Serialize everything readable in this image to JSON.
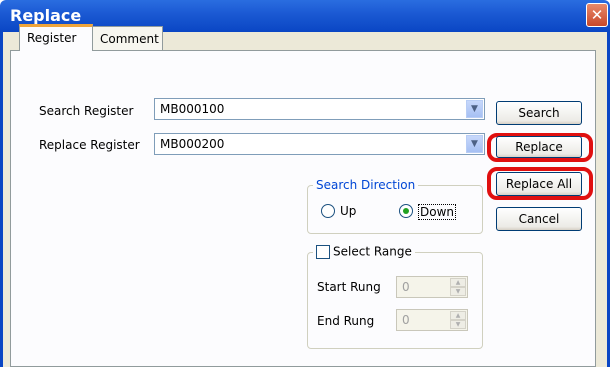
{
  "window": {
    "title": "Replace",
    "close_glyph": "✕"
  },
  "tabs": [
    {
      "label": "Register",
      "active": true
    },
    {
      "label": "Comment",
      "active": false
    }
  ],
  "search_register": {
    "label": "Search Register",
    "value": "MB000100"
  },
  "replace_register": {
    "label": "Replace Register",
    "value": "MB000200"
  },
  "buttons": {
    "search": "Search",
    "replace": "Replace",
    "replace_all": "Replace All",
    "cancel": "Cancel"
  },
  "search_direction": {
    "label": "Search Direction",
    "options": [
      {
        "label": "Up",
        "selected": false
      },
      {
        "label": "Down",
        "selected": true
      }
    ]
  },
  "select_range": {
    "label": "Select Range",
    "checked": false,
    "start_rung": {
      "label": "Start Rung",
      "value": "0"
    },
    "end_rung": {
      "label": "End Rung",
      "value": "0"
    }
  },
  "colors": {
    "titlebar": "#0a46c4",
    "highlight": "#e01010",
    "radio_selected": "#21a121"
  },
  "icons": {
    "dropdown": "chevron-down-icon",
    "close": "close-icon",
    "spin_up": "arrow-up-icon",
    "spin_down": "arrow-down-icon"
  }
}
